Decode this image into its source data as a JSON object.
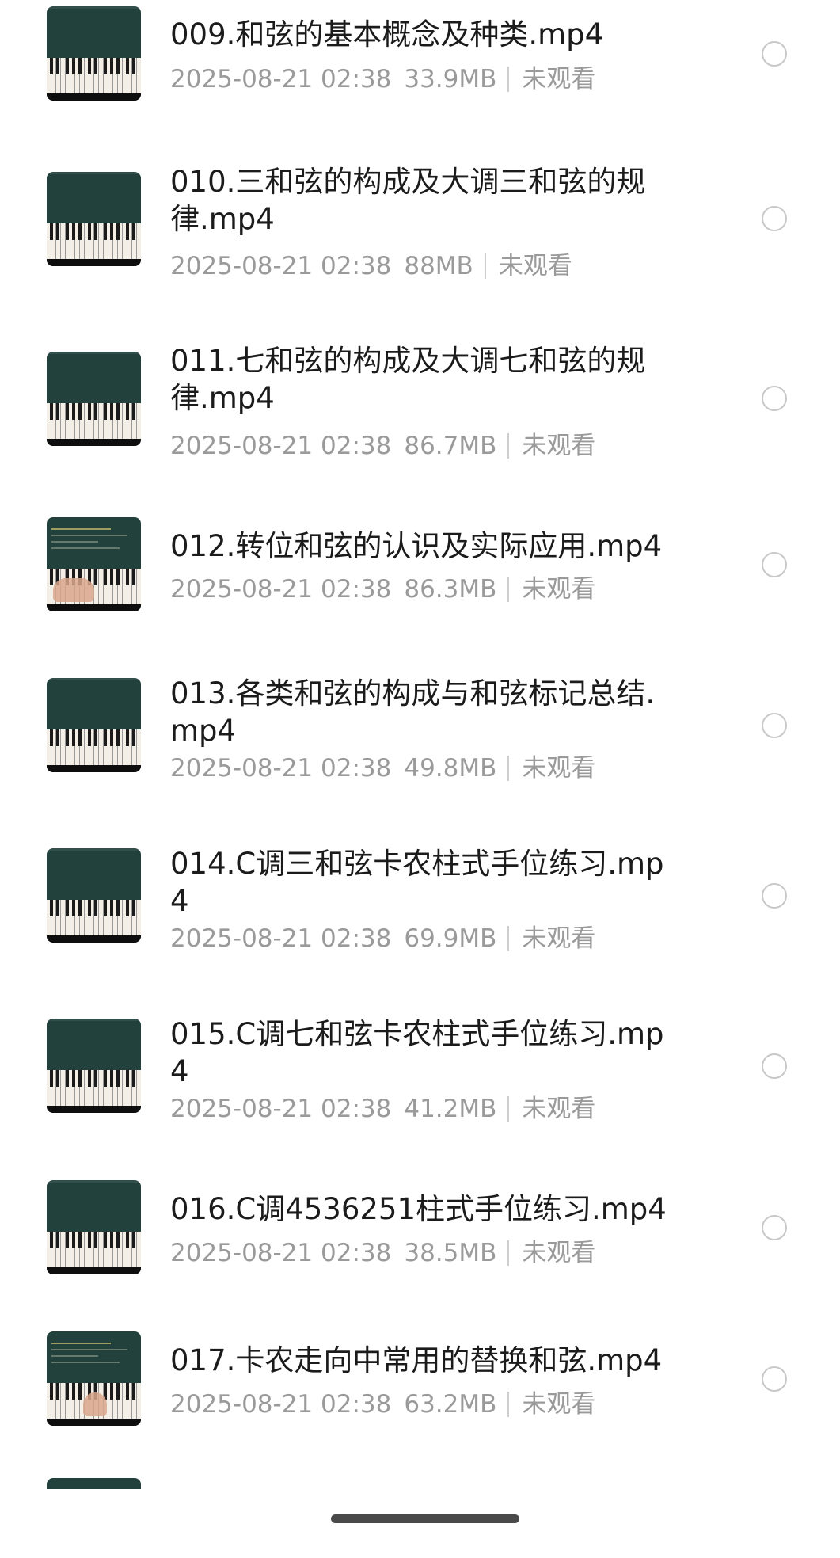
{
  "videos": [
    {
      "title": "009.和弦的基本概念及种类.mp4",
      "date": "2025-08-21 02:38",
      "size": "33.9MB",
      "status": "未观看",
      "thumbnail": "piano-keys"
    },
    {
      "title": "010.三和弦的构成及大调三和弦的规律.mp4",
      "date": "2025-08-21 02:38",
      "size": "88MB",
      "status": "未观看",
      "thumbnail": "piano-keys"
    },
    {
      "title": "011.七和弦的构成及大调七和弦的规律.mp4",
      "date": "2025-08-21 02:38",
      "size": "86.7MB",
      "status": "未观看",
      "thumbnail": "piano-keys"
    },
    {
      "title": "012.转位和弦的认识及实际应用.mp4",
      "date": "2025-08-21 02:38",
      "size": "86.3MB",
      "status": "未观看",
      "thumbnail": "piano-lesson-hands"
    },
    {
      "title": "013.各类和弦的构成与和弦标记总结.mp4",
      "date": "2025-08-21 02:38",
      "size": "49.8MB",
      "status": "未观看",
      "thumbnail": "piano-keys"
    },
    {
      "title": "014.C调三和弦卡农柱式手位练习.mp4",
      "date": "2025-08-21 02:38",
      "size": "69.9MB",
      "status": "未观看",
      "thumbnail": "piano-keys"
    },
    {
      "title": "015.C调七和弦卡农柱式手位练习.mp4",
      "date": "2025-08-21 02:38",
      "size": "41.2MB",
      "status": "未观看",
      "thumbnail": "piano-keys"
    },
    {
      "title": "016.C调4536251柱式手位练习.mp4",
      "date": "2025-08-21 02:38",
      "size": "38.5MB",
      "status": "未观看",
      "thumbnail": "piano-keys"
    },
    {
      "title": "017.卡农走向中常用的替换和弦.mp4",
      "date": "2025-08-21 02:38",
      "size": "63.2MB",
      "status": "未观看",
      "thumbnail": "piano-lesson-hands"
    }
  ],
  "colors": {
    "title": "#1b1b1b",
    "meta": "#9a9a9a",
    "thumbnail_bg": "#22403c",
    "radio_border": "#c8c8c8"
  }
}
